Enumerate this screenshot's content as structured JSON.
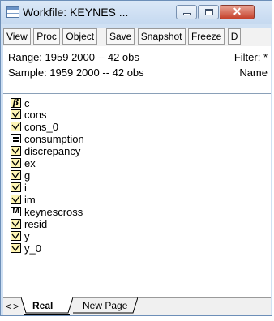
{
  "window": {
    "title": "Workfile: KEYNES ...",
    "close_glyph": "✕"
  },
  "toolbar": {
    "buttons": [
      "View",
      "Proc",
      "Object",
      "Save",
      "Snapshot",
      "Freeze",
      "D"
    ]
  },
  "info": {
    "range": "Range:  1959 2000  --  42 obs",
    "filter": "Filter: *",
    "sample": "Sample: 1959 2000  --  42 obs",
    "name": "Name"
  },
  "objects": [
    {
      "name": "c",
      "icon": "coefficient-icon"
    },
    {
      "name": "cons",
      "icon": "series-icon"
    },
    {
      "name": "cons_0",
      "icon": "series-icon"
    },
    {
      "name": "consumption",
      "icon": "equation-icon"
    },
    {
      "name": "discrepancy",
      "icon": "series-icon"
    },
    {
      "name": "ex",
      "icon": "series-icon"
    },
    {
      "name": "g",
      "icon": "series-icon"
    },
    {
      "name": "i",
      "icon": "series-icon"
    },
    {
      "name": "im",
      "icon": "series-icon"
    },
    {
      "name": "keynescross",
      "icon": "model-icon"
    },
    {
      "name": "resid",
      "icon": "series-icon"
    },
    {
      "name": "y",
      "icon": "series-icon"
    },
    {
      "name": "y_0",
      "icon": "series-icon"
    }
  ],
  "icon_glyphs": {
    "coefficient": "β",
    "model": "M"
  },
  "tabs": {
    "nav_left": "<",
    "nav_right": ">",
    "items": [
      "Real",
      "New Page"
    ],
    "active": "Real"
  }
}
